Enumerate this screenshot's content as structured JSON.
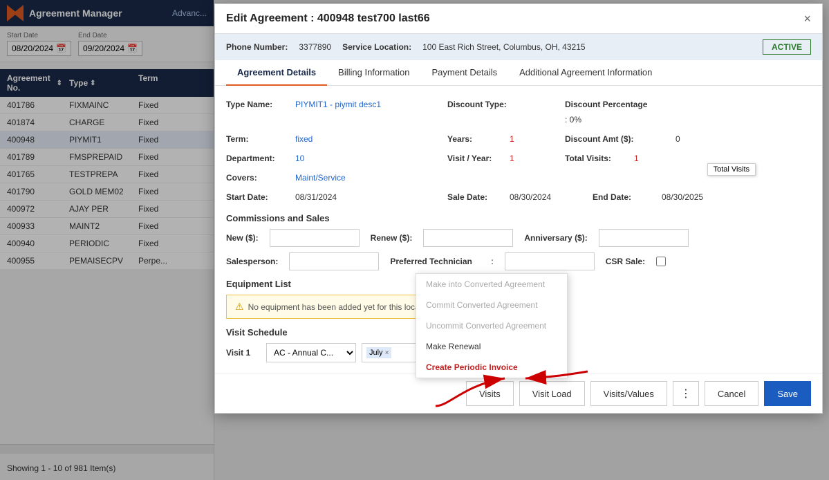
{
  "app": {
    "title": "Agreement Manager",
    "advanced_label": "Advanc..."
  },
  "date_filter": {
    "start_label": "Start Date",
    "start_value": "08/20/2024",
    "end_label": "End Date",
    "end_value": "09/20/2024"
  },
  "table": {
    "columns": [
      "Agreement No.",
      "Type",
      "Term"
    ],
    "rows": [
      {
        "agr": "401786",
        "type": "FIXMAINC",
        "term": "Fixed"
      },
      {
        "agr": "401874",
        "type": "CHARGE",
        "term": "Fixed"
      },
      {
        "agr": "400948",
        "type": "PIYMIT1",
        "term": "Fixed",
        "highlight": true
      },
      {
        "agr": "401789",
        "type": "FMSPREPAID",
        "term": "Fixed"
      },
      {
        "agr": "401765",
        "type": "TESTPREPA",
        "term": "Fixed"
      },
      {
        "agr": "401790",
        "type": "GOLD MEM02",
        "term": "Fixed"
      },
      {
        "agr": "400972",
        "type": "AJAY PER",
        "term": "Fixed"
      },
      {
        "agr": "400933",
        "type": "MAINT2",
        "term": "Fixed"
      },
      {
        "agr": "400940",
        "type": "PERIODIC",
        "term": "Fixed"
      },
      {
        "agr": "400955",
        "type": "PEMAISECPV",
        "term": "Perpe..."
      }
    ],
    "showing": "Showing 1 - 10 of 981 Item(s)"
  },
  "modal": {
    "title": "Edit Agreement : 400948 test700 last66",
    "close_label": "×",
    "phone_label": "Phone Number:",
    "phone_value": "3377890",
    "service_label": "Service Location:",
    "service_value": "100 East Rich Street, Columbus, OH, 43215",
    "status": "ACTIVE",
    "tabs": [
      "Agreement Details",
      "Billing Information",
      "Payment Details",
      "Additional Agreement Information"
    ],
    "active_tab": 0,
    "fields": {
      "type_name_label": "Type Name:",
      "type_name_value": "PIYMIT1 - piymit desc1",
      "discount_type_label": "Discount Type:",
      "discount_pct_label": "Discount Percentage",
      "discount_pct_value": ": 0%",
      "term_label": "Term:",
      "term_value": "fixed",
      "years_label": "Years:",
      "years_value": "1",
      "discount_amt_label": "Discount Amt ($):",
      "discount_amt_value": "0",
      "department_label": "Department:",
      "department_value": "10",
      "visit_year_label": "Visit / Year:",
      "visit_year_value": "1",
      "total_visits_label": "Total Visits:",
      "total_visits_value": "1",
      "total_visits_tooltip": "Total Visits",
      "covers_label": "Covers:",
      "covers_value": "Maint/Service",
      "start_date_label": "Start Date:",
      "start_date_value": "08/31/2024",
      "sale_date_label": "Sale Date:",
      "sale_date_value": "08/30/2024",
      "end_date_label": "End Date:",
      "end_date_value": "08/30/2025"
    },
    "commissions": {
      "title": "Commissions and Sales",
      "new_label": "New ($):",
      "renew_label": "Renew ($):",
      "anniversary_label": "Anniversary ($):",
      "salesperson_label": "Salesperson:",
      "preferred_tech_label": "Preferred Technician",
      "preferred_tech_colon": ":",
      "csr_sale_label": "CSR Sale:"
    },
    "equipment": {
      "title": "Equipment List",
      "notice": "No equipment has been added yet for this location."
    },
    "visit_schedule": {
      "title": "Visit Schedule",
      "visit1_label": "Visit 1",
      "dropdown_value": "AC - Annual C...",
      "tag_value": "July",
      "tag_remove": "×"
    },
    "footer": {
      "visits_btn": "Visits",
      "visit_load_btn": "Visit Load",
      "visits_values_btn": "Visits/Values",
      "dots_label": "⋮",
      "cancel_btn": "Cancel",
      "save_btn": "Save"
    },
    "context_menu": {
      "items": [
        {
          "label": "Make into Converted Agreement",
          "disabled": true
        },
        {
          "label": "Commit Converted Agreement",
          "disabled": true
        },
        {
          "label": "Uncommit Converted Agreement",
          "disabled": true
        },
        {
          "label": "Make Renewal",
          "disabled": false
        },
        {
          "label": "Create Periodic Invoice",
          "disabled": false,
          "highlighted": true
        }
      ]
    }
  }
}
